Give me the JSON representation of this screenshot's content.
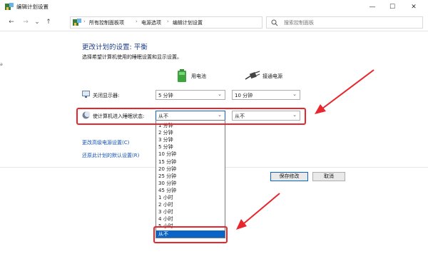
{
  "window": {
    "title": "编辑计划设置",
    "minimize": "—",
    "maximize": "☐",
    "close": "✕"
  },
  "nav": {
    "back": "←",
    "forward": "→",
    "recent": "⌄",
    "up": "↑",
    "breadcrumbs": [
      "所有控制面板项",
      "电源选项",
      "编辑计划设置"
    ],
    "separator": "›",
    "dropdown": "⌄",
    "refresh": "↻",
    "search_placeholder": "搜索控制面板"
  },
  "side_mark": "ə",
  "page": {
    "title": "更改计划的设置: 平衡",
    "subtitle": "选择希望计算机使用的睡眠设置和显示设置。",
    "col_battery": "用电池",
    "col_plugged": "接通电源"
  },
  "rows": {
    "display_off": {
      "label": "关闭显示器:",
      "battery_value": "5 分钟",
      "plugged_value": "10 分钟"
    },
    "sleep": {
      "label": "使计算机进入睡眠状态:",
      "battery_value": "从不",
      "plugged_value": "从不"
    }
  },
  "chevron": "⌄",
  "links": {
    "advanced": "更改高级电源设置(C)",
    "restore": "还原此计划的默认设置(R)"
  },
  "buttons": {
    "save": "保存修改",
    "cancel": "取消"
  },
  "dropdown_options": [
    "1 分钟",
    "2 分钟",
    "3 分钟",
    "5 分钟",
    "10 分钟",
    "15 分钟",
    "20 分钟",
    "25 分钟",
    "30 分钟",
    "45 分钟",
    "1 小时",
    "2 小时",
    "3 小时",
    "4 小时",
    "5 小时",
    "从不"
  ],
  "dropdown_selected_index": 15,
  "colors": {
    "annotation_red": "#e8262c",
    "selection_blue": "#0a64c8",
    "title_blue": "#1e3e8a",
    "link_blue": "#1552b3"
  }
}
